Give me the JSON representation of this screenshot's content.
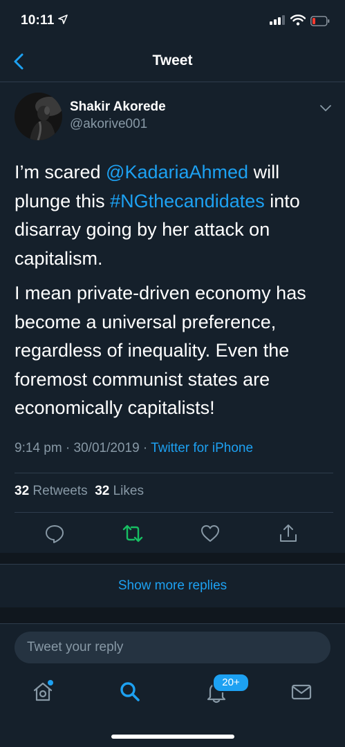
{
  "status_bar": {
    "time": "10:11"
  },
  "header": {
    "title": "Tweet"
  },
  "tweet": {
    "author_name": "Shakir Akorede",
    "author_handle": "@akorive001",
    "p1_a": "I’m scared ",
    "p1_mention": "@KadariaAhmed",
    "p1_b": " will plunge this ",
    "p1_hashtag": "#NGthecandidates",
    "p1_c": " into disarray going by her attack on capitalism.",
    "p2": "I mean private-driven economy has become a universal preference, regardless of inequality. Even the foremost communist states are economically capitalists!",
    "timestamp": "9:14 pm · 30/01/2019 · ",
    "source": "Twitter for iPhone",
    "retweet_count": "32",
    "retweet_label": "Retweets",
    "like_count": "32",
    "like_label": "Likes"
  },
  "show_more": "Show more replies",
  "composer": {
    "placeholder": "Tweet your reply"
  },
  "tabbar": {
    "notifications_badge": "20+"
  },
  "colors": {
    "background": "#15202b",
    "accent": "#1da1f2",
    "muted": "#8899a6",
    "retweet_active": "#17bf63"
  },
  "icons": [
    "back-chevron-icon",
    "caret-down-icon",
    "reply-icon",
    "retweet-icon",
    "like-icon",
    "share-icon",
    "home-icon",
    "search-icon",
    "notifications-icon",
    "messages-icon"
  ]
}
